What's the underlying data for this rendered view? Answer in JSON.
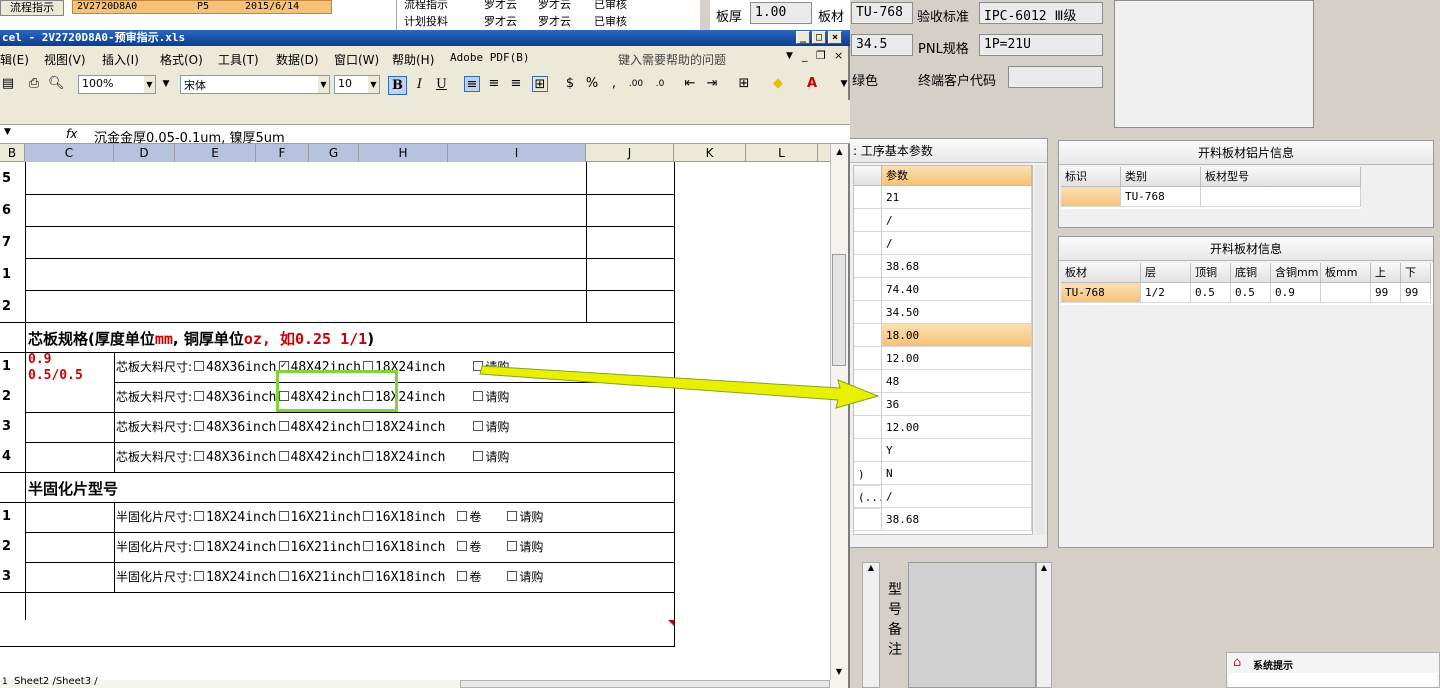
{
  "background_app": {
    "top_strip": {
      "button": "流程指示",
      "row1": [
        "2V2720D8A0",
        "P5",
        "2015/6/14"
      ],
      "row2": [
        "流程指示",
        "罗才云",
        "罗才云",
        "已审核"
      ],
      "row3": [
        "计划投料",
        "罗才云",
        "罗才云",
        "已审核"
      ]
    },
    "fields": {
      "board_thickness_label": "板厚",
      "board_thickness_value": "1.00",
      "material_label": "板材",
      "material_value": "TU-768",
      "acceptance_label": "验收标准",
      "acceptance_value": "IPC-6012 Ⅲ级",
      "value_345": "34.5",
      "pnl_label": "PNL规格",
      "pnl_value": "1P=21U",
      "color_label": "绿色",
      "customer_code_label": "终端客户代码",
      "customer_code_value": ""
    },
    "process_params_panel": {
      "title": ": 工序基本参数",
      "header": "参数",
      "left_fragments": [
        ")",
        "(..."
      ],
      "values": [
        "21",
        "/",
        "/",
        "38.68",
        "74.40",
        "34.50",
        "18.00",
        "12.00",
        "48",
        "36",
        "12.00",
        "Y",
        "N",
        "/",
        "38.68"
      ],
      "highlight_index": 6
    },
    "aluminum_panel": {
      "title": "开料板材铝片信息",
      "headers": [
        "标识",
        "类别",
        "板材型号"
      ],
      "row": [
        "",
        "TU-768",
        ""
      ]
    },
    "material_panel": {
      "title": "开料板材信息",
      "headers": [
        "板材",
        "层",
        "顶铜",
        "底铜",
        "含铜mm",
        "板mm",
        "上",
        "下"
      ],
      "row": [
        "TU-768",
        "1/2",
        "0.5",
        "0.5",
        "0.9",
        "",
        "99",
        "99"
      ]
    },
    "remarks_label": [
      "型",
      "号",
      "备",
      "注"
    ],
    "sys_tip": "系统提示"
  },
  "excel": {
    "title": "cel - 2V2720D8A0-预审指示.xls",
    "menus": [
      "辑(E)",
      "视图(V)",
      "插入(I)",
      "格式(O)",
      "工具(T)",
      "数据(D)",
      "窗口(W)",
      "帮助(H)",
      "Adobe PDF(B)"
    ],
    "help_placeholder": "键入需要帮助的问题",
    "zoom": "100%",
    "font": "宋体",
    "font_size": "10",
    "fmt_buttons": [
      "B",
      "I",
      "U"
    ],
    "formula_fx": "fx",
    "formula": "沉金金厚0.05-0.1um, 镍厚5um",
    "columns": [
      "B",
      "C",
      "D",
      "E",
      "F",
      "G",
      "H",
      "I",
      "J",
      "K",
      "L"
    ],
    "rows": {
      "blank_labels": [
        "5",
        "6",
        "7",
        "1",
        "2"
      ],
      "core_header": {
        "prefix": "芯板规格(厚度单位",
        "unit1": "mm",
        "mid": ", 铜厚单位",
        "unit2": "oz, 如0.25 1/1",
        "suffix": ")"
      },
      "core_rows": [
        {
          "label": "1",
          "c_line1": "0.9",
          "c_line2": "0.5/0.5",
          "prefix": "芯板大料尺寸:",
          "opt1": "48X36inch",
          "opt2": "48X42inch",
          "opt3": "18X24inch",
          "opt4": "请购",
          "checked": 2
        },
        {
          "label": "2",
          "c_line1": "",
          "c_line2": "",
          "prefix": "芯板大料尺寸:",
          "opt1": "48X36inch",
          "opt2": "48X42inch",
          "opt3": "18X24inch",
          "opt4": "请购",
          "checked": 0
        },
        {
          "label": "3",
          "c_line1": "",
          "c_line2": "",
          "prefix": "芯板大料尺寸:",
          "opt1": "48X36inch",
          "opt2": "48X42inch",
          "opt3": "18X24inch",
          "opt4": "请购",
          "checked": 0
        },
        {
          "label": "4",
          "c_line1": "",
          "c_line2": "",
          "prefix": "芯板大料尺寸:",
          "opt1": "48X36inch",
          "opt2": "48X42inch",
          "opt3": "18X24inch",
          "opt4": "请购",
          "checked": 0
        }
      ],
      "prepreg_header": "半固化片型号",
      "prepreg_rows": [
        {
          "label": "1",
          "prefix": "半固化片尺寸:",
          "opt1": "18X24inch",
          "opt2": "16X21inch",
          "opt3": "16X18inch",
          "opt4": "卷",
          "opt5": "请购"
        },
        {
          "label": "2",
          "prefix": "半固化片尺寸:",
          "opt1": "18X24inch",
          "opt2": "16X21inch",
          "opt3": "16X18inch",
          "opt4": "卷",
          "opt5": "请购"
        },
        {
          "label": "3",
          "prefix": "半固化片尺寸:",
          "opt1": "18X24inch",
          "opt2": "16X21inch",
          "opt3": "16X18inch",
          "opt4": "卷",
          "opt5": "请购"
        }
      ]
    },
    "sheet_tabs": "Sheet2 /Sheet3 /",
    "sheet_tab_num": "1"
  },
  "colors": {
    "accent_red": "#cc0000",
    "highlight_green": "#7fd43a",
    "arrow_yellow": "#e8f000",
    "orange_cell": "#f6c27a",
    "title_blue": "#0a3c8c"
  }
}
